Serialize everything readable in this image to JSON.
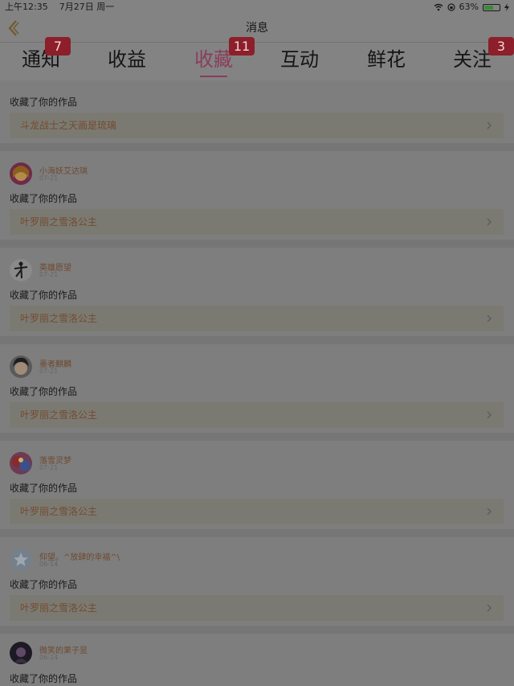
{
  "status_bar": {
    "time": "上午12:35",
    "date": "7月27日 周一",
    "battery": "63%",
    "battery_level": 0.63
  },
  "header": {
    "title": "消息",
    "back_icon": "chevron-left-icon"
  },
  "tabs": [
    {
      "label": "通知",
      "badge": "7",
      "active": false
    },
    {
      "label": "收益",
      "badge": "",
      "active": false
    },
    {
      "label": "收藏",
      "badge": "11",
      "active": true
    },
    {
      "label": "互动",
      "badge": "",
      "active": false
    },
    {
      "label": "鲜花",
      "badge": "",
      "active": false
    },
    {
      "label": "关注",
      "badge": "3",
      "active": false
    }
  ],
  "items": [
    {
      "user": "",
      "date": "",
      "action": "收藏了你的作品",
      "work": "斗龙战士之天画是琉璃"
    },
    {
      "user": "小海妖艾达琪",
      "date": "07-21",
      "action": "收藏了你的作品",
      "work": "叶罗丽之雪洛公主"
    },
    {
      "user": "英雄愿望",
      "date": "07-21",
      "action": "收藏了你的作品",
      "work": "叶罗丽之雪洛公主"
    },
    {
      "user": "墨者麒麟",
      "date": "07-21",
      "action": "收藏了你的作品",
      "work": "叶罗丽之雪洛公主"
    },
    {
      "user": "落雪灵梦",
      "date": "07-21",
      "action": "收藏了你的作品",
      "work": "叶罗丽之雪洛公主"
    },
    {
      "user": "仰望。^放肆的幸福^\\",
      "date": "06-14",
      "action": "收藏了你的作品",
      "work": "叶罗丽之雪洛公主"
    },
    {
      "user": "微笑的果子昱",
      "date": "06-14",
      "action": "收藏了你的作品",
      "work": ""
    }
  ]
}
